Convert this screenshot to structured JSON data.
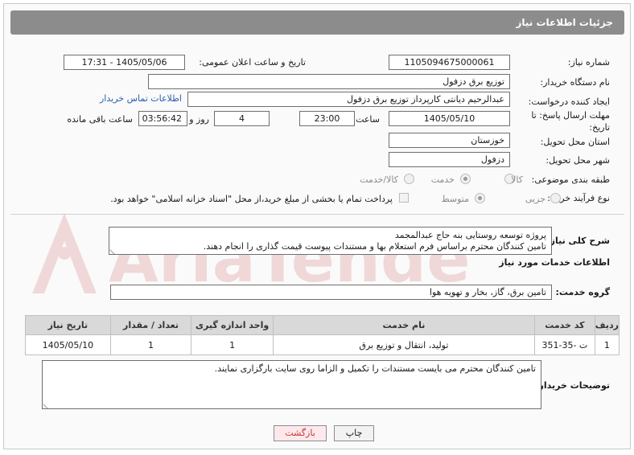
{
  "header": {
    "title": "جزئیات اطلاعات نیاز"
  },
  "form": {
    "need_number_label": "شماره نیاز:",
    "need_number": "1105094675000061",
    "announce_datetime_label": "تاریخ و ساعت اعلان عمومی:",
    "announce_datetime": "1405/05/06 - 17:31",
    "buyer_org_label": "نام دستگاه خریدار:",
    "buyer_org": "توزیع برق دزفول",
    "requester_label": "ایجاد کننده درخواست:",
    "requester": "عبدالرحیم دیانتی کارپرداز توزیع برق دزفول",
    "buyer_contact_link": "اطلاعات تماس خریدار",
    "deadline_label": "مهلت ارسال پاسخ: تا تاریخ:",
    "deadline_date": "1405/05/10",
    "time_label": "ساعت",
    "deadline_time": "23:00",
    "days_count": "4",
    "days_label": "روز و",
    "remaining_time": "03:56:42",
    "remaining_label": "ساعت باقی مانده",
    "province_label": "استان محل تحویل:",
    "province": "خوزستان",
    "city_label": "شهر محل تحویل:",
    "city": "دزفول",
    "category_label": "طبقه بندی موضوعی:",
    "category_options": [
      "کالا",
      "خدمت",
      "کالا/خدمت"
    ],
    "category_selected": "خدمت",
    "process_label": "نوع فرآیند خرید :",
    "process_options": [
      "جزیی",
      "متوسط"
    ],
    "process_selected": "متوسط",
    "payment_note": "پرداخت تمام یا بخشی از مبلغ خرید،از محل \"اسناد خزانه اسلامی\" خواهد بود."
  },
  "description": {
    "label": "شرح کلی نیاز:",
    "line1": "پروژه توسعه روستایی بنه حاج عبدالمجمد",
    "line2": "تامین کنندگان محترم براساس فرم استعلام بها و مستندات پیوست قیمت گذاری را انجام دهند."
  },
  "services": {
    "section_title": "اطلاعات خدمات مورد نیاز",
    "group_label": "گروه خدمت:",
    "group_value": "تامین برق، گاز، بخار و تهویه هوا",
    "columns": [
      "ردیف",
      "کد خدمت",
      "نام خدمت",
      "واحد اندازه گیری",
      "تعداد / مقدار",
      "تاریخ نیاز"
    ],
    "rows": [
      [
        "1",
        "ت -35-351",
        "تولید، انتقال و توزیع برق",
        "1",
        "1",
        "1405/05/10"
      ]
    ]
  },
  "buyer_notes": {
    "label": "توضیحات خریدار:",
    "text": "تامین کنندگان محترم می بایست مستندات را تکمیل و الزاما روی سایت بارگزاری نمایند."
  },
  "buttons": {
    "print": "چاپ",
    "back": "بازگشت"
  },
  "watermark": {
    "text": "AriaTender.neT"
  },
  "colors": {
    "header_bg": "#8c8c8c",
    "link": "#2a5db0",
    "back_button_text": "#c0392b",
    "back_button_bg": "#fde8ec"
  }
}
